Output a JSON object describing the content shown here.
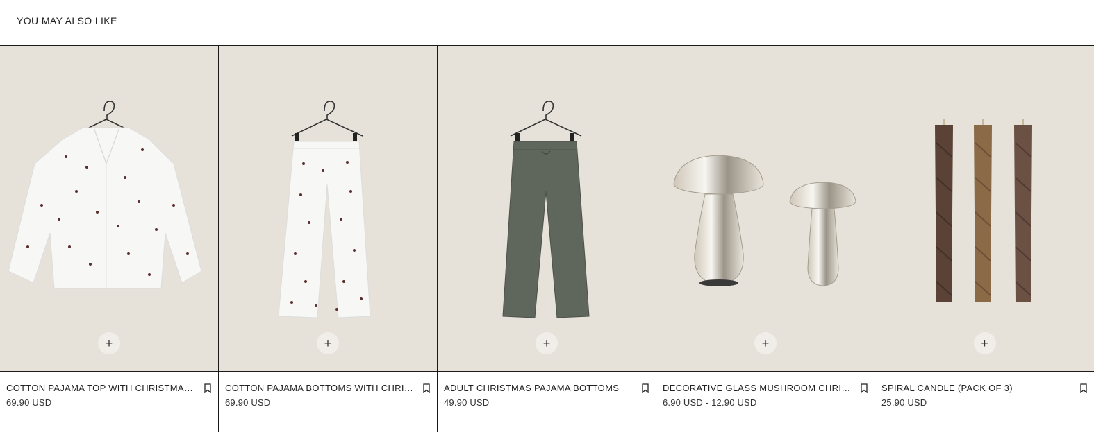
{
  "section": {
    "title": "YOU MAY ALSO LIKE"
  },
  "colors": {
    "card_bg": "#e6e1d9",
    "divider": "#1a1a1a"
  },
  "products": [
    {
      "name": "COTTON PAJAMA TOP WITH CHRISTMAS SPRIG PRINT",
      "price": "69.90 USD",
      "add_label": "+",
      "image_icon": "pajama-top-icon"
    },
    {
      "name": "COTTON PAJAMA BOTTOMS WITH CHRISTMAS SPRIG PRINT",
      "price": "69.90 USD",
      "add_label": "+",
      "image_icon": "pajama-bottoms-icon"
    },
    {
      "name": "ADULT CHRISTMAS PAJAMA BOTTOMS",
      "price": "49.90 USD",
      "add_label": "+",
      "image_icon": "green-pajama-bottoms-icon"
    },
    {
      "name": "DECORATIVE GLASS MUSHROOM CHRISTMAS ORNAMENT",
      "price": "6.90 USD - 12.90 USD",
      "add_label": "+",
      "image_icon": "glass-mushroom-icon"
    },
    {
      "name": "SPIRAL CANDLE (PACK OF 3)",
      "price": "25.90 USD",
      "add_label": "+",
      "image_icon": "spiral-candle-icon"
    }
  ]
}
